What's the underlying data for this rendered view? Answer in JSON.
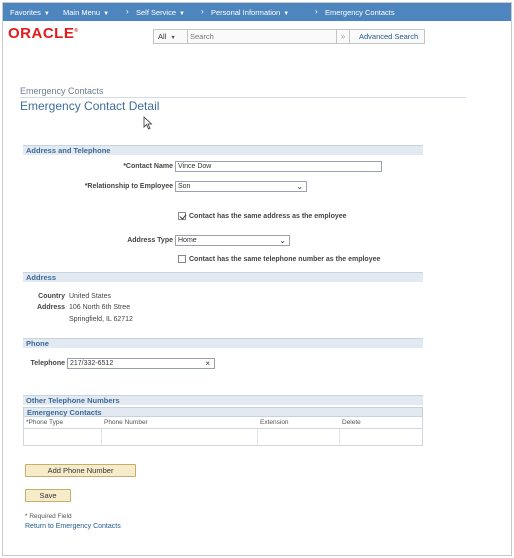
{
  "topnav": {
    "favorites": "Favorites",
    "main_menu": "Main Menu",
    "self_service": "Self Service",
    "personal_information": "Personal Information",
    "emergency_contacts": "Emergency Contacts"
  },
  "header": {
    "logo": "ORACLE",
    "search_scope": "All",
    "search_placeholder": "Search",
    "go_symbol": "»",
    "advanced_search": "Advanced Search"
  },
  "page": {
    "breadcrumb": "Emergency Contacts",
    "title": "Emergency Contact Detail"
  },
  "address_telephone": {
    "section_title": "Address and Telephone",
    "contact_name_label": "*Contact Name",
    "contact_name_value": "Vince Dow",
    "relationship_label": "*Relationship to Employee",
    "relationship_value": "Son",
    "same_address_label": "Contact has the same address as the employee",
    "same_address_checked": true,
    "address_type_label": "Address Type",
    "address_type_value": "Home",
    "same_phone_label": "Contact has the same telephone number as the employee",
    "same_phone_checked": false
  },
  "address": {
    "section_title": "Address",
    "country_label": "Country",
    "country_value": "United States",
    "address_label": "Address",
    "address_line1": "106 North 6th Stree",
    "address_line2": "Springfield, IL 62712"
  },
  "phone": {
    "section_title": "Phone",
    "telephone_label": "Telephone",
    "telephone_value": "217/332-6512",
    "clear_symbol": "×"
  },
  "other_numbers": {
    "section_title": "Other Telephone Numbers",
    "grid_title": "Emergency Contacts",
    "columns": [
      "*Phone Type",
      "Phone Number",
      "Extension",
      "Delete"
    ],
    "add_button": "Add Phone Number"
  },
  "footer": {
    "save_button": "Save",
    "required_note": "* Required Field",
    "return_link": "Return to Emergency Contacts"
  },
  "colors": {
    "nav_bg": "#4d86bf",
    "logo_red": "#e01b1b",
    "section_bg": "#e2e9f1",
    "section_text": "#3d6a97",
    "button_bg": "#f7ecc9",
    "link": "#1f5a8f"
  }
}
